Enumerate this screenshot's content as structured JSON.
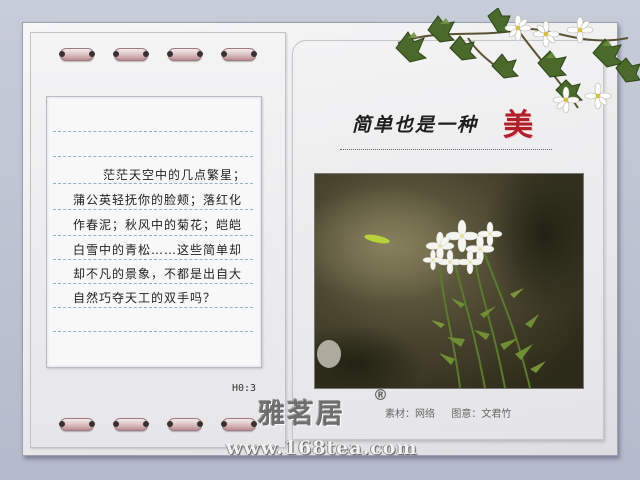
{
  "title": {
    "text": "简单也是一种",
    "accent": "美"
  },
  "poem": {
    "lines": [
      "茫茫天空中的几点繁星；",
      "蒲公英轻抚你的脸颊；落红化",
      "作春泥；秋风中的菊花；皑皑",
      "白雪中的青松……这些简单却",
      "却不凡的景象，不都是出自大",
      "自然巧夺天工的双手吗？"
    ]
  },
  "page_code": "H0:3",
  "credits": {
    "material": "素材：网络",
    "design": "图意：文君竹"
  },
  "watermark": {
    "logo_text": "雅茗居",
    "registered": "®",
    "site": "www.168tea.com"
  },
  "colors": {
    "accent": "#b0202a",
    "rule": "#8fb3c9",
    "frame": "#b9bfd0"
  },
  "icons": {
    "binder_rings": "binder-ring-icon",
    "decoration": "ivy-flower-icon"
  }
}
